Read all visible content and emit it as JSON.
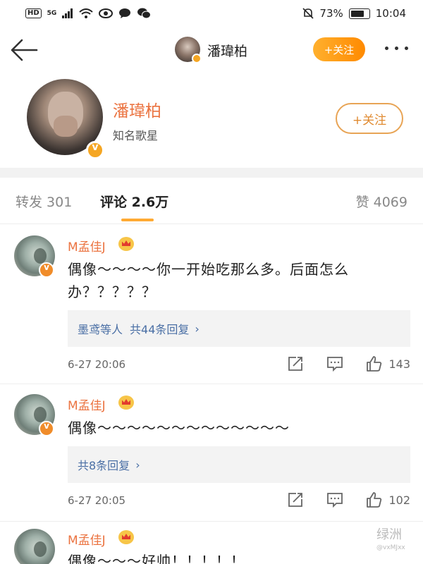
{
  "status_bar": {
    "hd_label": "HD",
    "signal_label": "5G",
    "battery_percent_text": "73%",
    "battery_level": 0.73,
    "time": "10:04"
  },
  "nav": {
    "title": "潘瑋柏",
    "follow_label": "+关注"
  },
  "profile": {
    "name": "潘瑋柏",
    "description": "知名歌星",
    "follow_label": "+关注"
  },
  "tabs": {
    "repost": "转发 301",
    "comments": "评论 2.6万",
    "likes": "赞 4069"
  },
  "comments": [
    {
      "user": "M孟佳J",
      "text": "偶像～～～～你一开始吃那么多。后面怎么办？？？？？",
      "replies_users": "墨鸢等人",
      "replies_count": "共44条回复",
      "time": "6-27 20:06",
      "likes": "143"
    },
    {
      "user": "M孟佳J",
      "text": "偶像～～～～～～～～～～～～～",
      "replies_count": "共8条回复",
      "time": "6-27 20:05",
      "likes": "102"
    },
    {
      "user": "M孟佳J",
      "text": "偶像～～～好帅！！！！！"
    }
  ],
  "watermark": {
    "line1": "绿洲",
    "line2": "@vxMJxx"
  },
  "colors": {
    "accent_orange": "#ff9a1a",
    "name_orange": "#eb7340",
    "link_blue": "#4a6fa5"
  }
}
